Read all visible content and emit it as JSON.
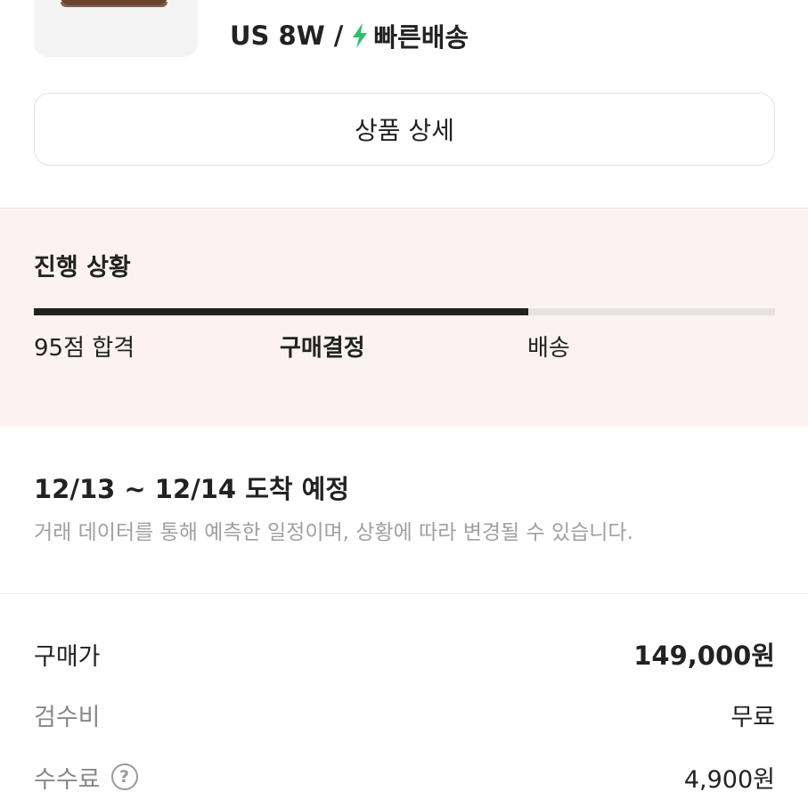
{
  "product": {
    "size": "US 8W /",
    "shipping_badge": "빠른배송",
    "bolt_icon": "lightning-bolt-icon",
    "bolt_color": "#2ebf6f"
  },
  "detail_button": {
    "label": "상품 상세"
  },
  "progress": {
    "title": "진행 상황",
    "fill_fraction": 0.667,
    "steps": [
      {
        "label": "95점 합격",
        "current": false
      },
      {
        "label": "구매결정",
        "current": true
      },
      {
        "label": "배송",
        "current": false
      }
    ]
  },
  "arrival": {
    "title": "12/13 ~ 12/14 도착 예정",
    "note": "거래 데이터를 통해 예측한 일정이며, 상황에 따라 변경될 수 있습니다."
  },
  "prices": [
    {
      "label": "구매가",
      "value": "149,000원"
    },
    {
      "label": "검수비",
      "value": "무료"
    },
    {
      "label": "수수료",
      "value": "4,900원",
      "help_icon": "question-circle-icon",
      "help_glyph": "?"
    }
  ]
}
